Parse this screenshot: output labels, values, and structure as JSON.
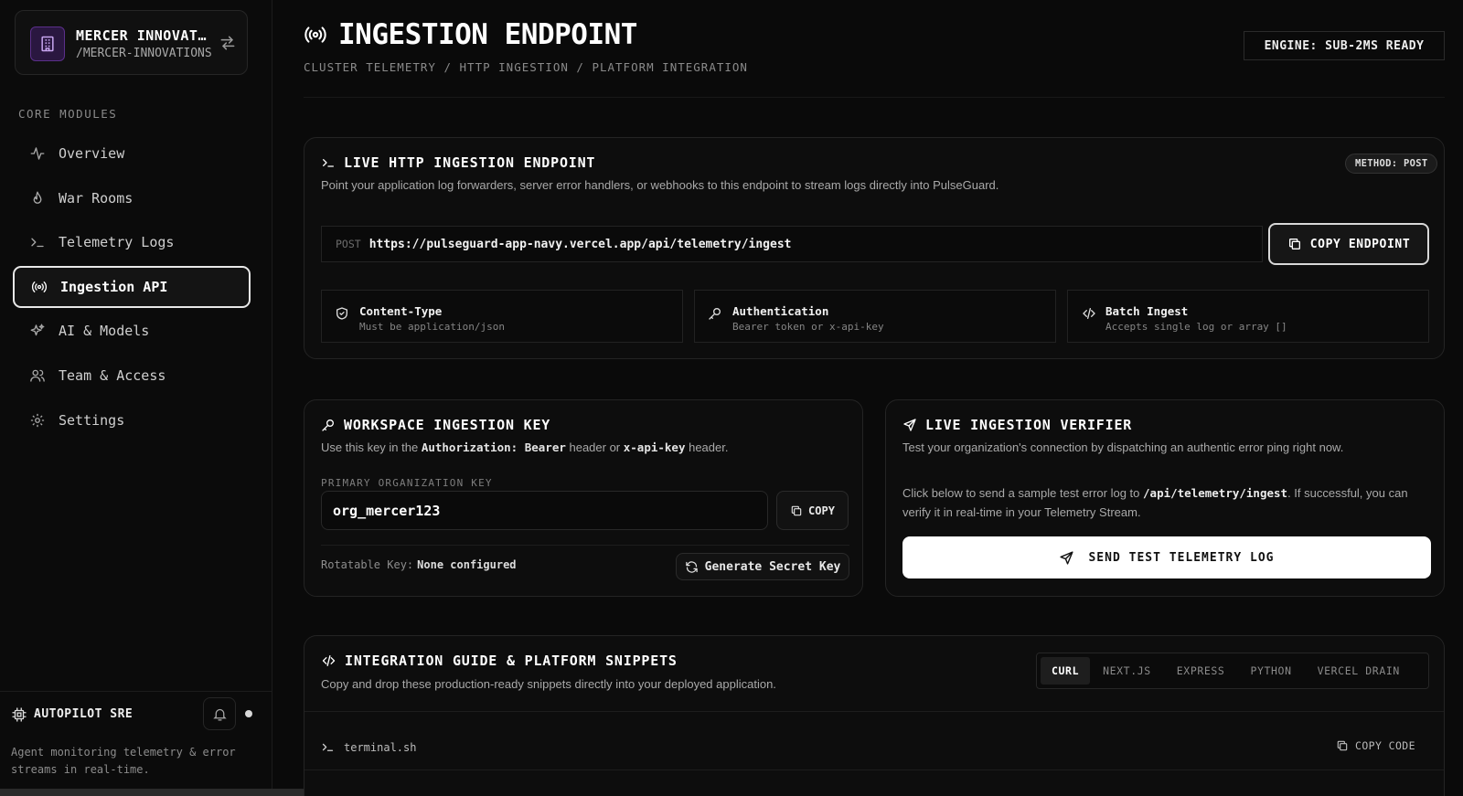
{
  "org": {
    "name": "MERCER INNOVATIONS",
    "slug": "/MERCER-INNOVATIONS"
  },
  "sidebar": {
    "section_label": "CORE MODULES",
    "items": [
      {
        "label": "Overview",
        "icon": "activity-icon"
      },
      {
        "label": "War Rooms",
        "icon": "flame-icon"
      },
      {
        "label": "Telemetry Logs",
        "icon": "terminal-icon"
      },
      {
        "label": "Ingestion API",
        "icon": "broadcast-icon",
        "active": true
      },
      {
        "label": "AI & Models",
        "icon": "sparkles-icon"
      },
      {
        "label": "Team & Access",
        "icon": "users-icon"
      },
      {
        "label": "Settings",
        "icon": "gear-icon"
      }
    ]
  },
  "autopilot": {
    "title": "AUTOPILOT SRE",
    "description": "Agent monitoring telemetry & error streams in real-time."
  },
  "header": {
    "title": "INGESTION ENDPOINT",
    "breadcrumb": "CLUSTER TELEMETRY / HTTP INGESTION / PLATFORM INTEGRATION",
    "engine_status": "ENGINE: SUB-2MS READY"
  },
  "endpoint_card": {
    "title": "LIVE HTTP INGESTION ENDPOINT",
    "method_badge": "METHOD: POST",
    "description": "Point your application log forwarders, server error handlers, or webhooks to this endpoint to stream logs directly into PulseGuard.",
    "verb": "POST",
    "url": "https://pulseguard-app-navy.vercel.app/api/telemetry/ingest",
    "copy_label": "COPY ENDPOINT",
    "features": [
      {
        "title": "Content-Type",
        "subtitle": "Must be application/json",
        "icon": "shield-check-icon"
      },
      {
        "title": "Authentication",
        "subtitle": "Bearer token or x-api-key",
        "icon": "key-icon"
      },
      {
        "title": "Batch Ingest",
        "subtitle": "Accepts single log or array []",
        "icon": "code-icon"
      }
    ]
  },
  "key_card": {
    "title": "WORKSPACE INGESTION KEY",
    "desc_prefix": "Use this key in the ",
    "desc_code1": "Authorization: Bearer",
    "desc_mid": " header or ",
    "desc_code2": "x-api-key",
    "desc_suffix": " header.",
    "field_label": "PRIMARY ORGANIZATION KEY",
    "key_value": "org_mercer123",
    "copy_label": "COPY",
    "rotatable_label": "Rotatable Key:",
    "rotatable_value": "None configured",
    "generate_label": "Generate Secret Key"
  },
  "verifier_card": {
    "title": "LIVE INGESTION VERIFIER",
    "description": "Test your organization's connection by dispatching an authentic error ping right now.",
    "body_prefix": "Click below to send a sample test error log to ",
    "body_code": "/api/telemetry/ingest",
    "body_suffix": ". If successful, you can verify it in real-time in your Telemetry Stream.",
    "button_label": "SEND TEST TELEMETRY LOG"
  },
  "guide_card": {
    "title": "INTEGRATION GUIDE & PLATFORM SNIPPETS",
    "description": "Copy and drop these production-ready snippets directly into your deployed application.",
    "tabs": [
      {
        "label": "CURL",
        "active": true
      },
      {
        "label": "NEXT.JS"
      },
      {
        "label": "EXPRESS"
      },
      {
        "label": "PYTHON"
      },
      {
        "label": "VERCEL DRAIN"
      }
    ],
    "file_name": "terminal.sh",
    "copy_code_label": "COPY CODE"
  }
}
